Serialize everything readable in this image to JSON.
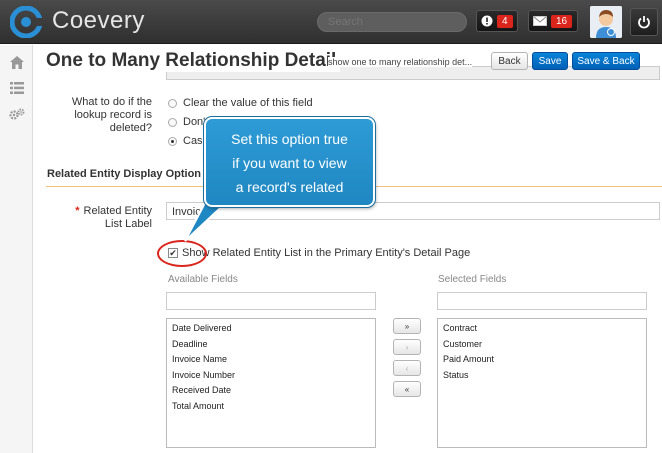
{
  "app": {
    "brand": "Coevery"
  },
  "topbar": {
    "search_placeholder": "Search",
    "alert_count": "4",
    "mail_count": "16"
  },
  "sidenav": {
    "items": [
      {
        "icon": "home-icon"
      },
      {
        "icon": "list-icon"
      },
      {
        "icon": "gears-icon"
      }
    ]
  },
  "header": {
    "title": "One to Many Relationship Detail",
    "subtitle": "show one to many relationship det...",
    "back_label": "Back",
    "save_label": "Save",
    "save_back_label": "Save & Back"
  },
  "colors": {
    "primary": "#0a84d8",
    "accent_rule": "#f2c078",
    "required": "#d9251c",
    "callout": "#2e9bd6"
  },
  "delete_option": {
    "label": "What to do if the lookup record is deleted?",
    "options": [
      {
        "label": "Clear the value of this field",
        "checked": false
      },
      {
        "label": "Don't",
        "checked": false
      },
      {
        "label": "Casc",
        "checked": true
      }
    ]
  },
  "callout": {
    "lines": [
      "Set this option true",
      "if you want to view",
      "a record's related"
    ]
  },
  "related_section": {
    "title": "Related Entity Display Option",
    "list_label_label": "Related Entity List Label",
    "list_label_value": "Invoice",
    "show_checkbox_label": "Show Related Entity List in the Primary Entity's Detail Page",
    "show_checked": true,
    "available_label": "Available Fields",
    "selected_label": "Selected Fields",
    "available_fields": [
      "Date Delivered",
      "Deadline",
      "Invoice Name",
      "Invoice Number",
      "Received Date",
      "Total Amount"
    ],
    "selected_fields": [
      "Contract",
      "Customer",
      "Paid Amount",
      "Status"
    ],
    "move_buttons": [
      "»",
      "›",
      "‹",
      "«"
    ]
  }
}
